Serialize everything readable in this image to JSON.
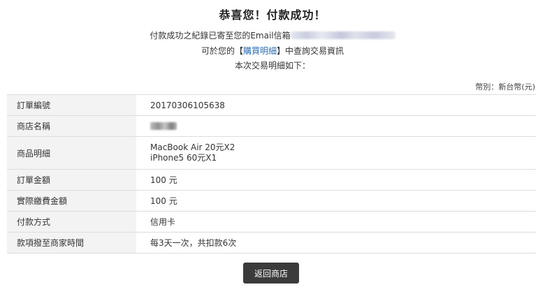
{
  "header": {
    "title": "恭喜您！付款成功！",
    "email_notice_prefix": "付款成功之紀錄已寄至您的Email信箱",
    "lookup_prefix": "可於您的【",
    "lookup_link": "購買明細",
    "lookup_suffix": "】中查詢交易資訊",
    "details_intro": "本次交易明細如下："
  },
  "currency_note": "幣別：新台幣(元)",
  "order": {
    "rows": [
      {
        "label": "訂單編號",
        "value": "20170306105638"
      },
      {
        "label": "商店名稱",
        "value": ""
      },
      {
        "label": "商品明細",
        "items": [
          "MacBook Air 20元X2",
          "iPhone5 60元X1"
        ]
      },
      {
        "label": "訂單金額",
        "value": "100 元"
      },
      {
        "label": "實際繳費金額",
        "value": "100 元"
      },
      {
        "label": "付款方式",
        "value": "信用卡"
      },
      {
        "label": "款項撥至商家時間",
        "value": "每3天一次，共扣款6次"
      }
    ]
  },
  "actions": {
    "back_label": "返回商店"
  },
  "colors": {
    "button_bg": "#3b3b3b",
    "link": "#2a6bb0",
    "label_bg": "#f3f3f3"
  }
}
